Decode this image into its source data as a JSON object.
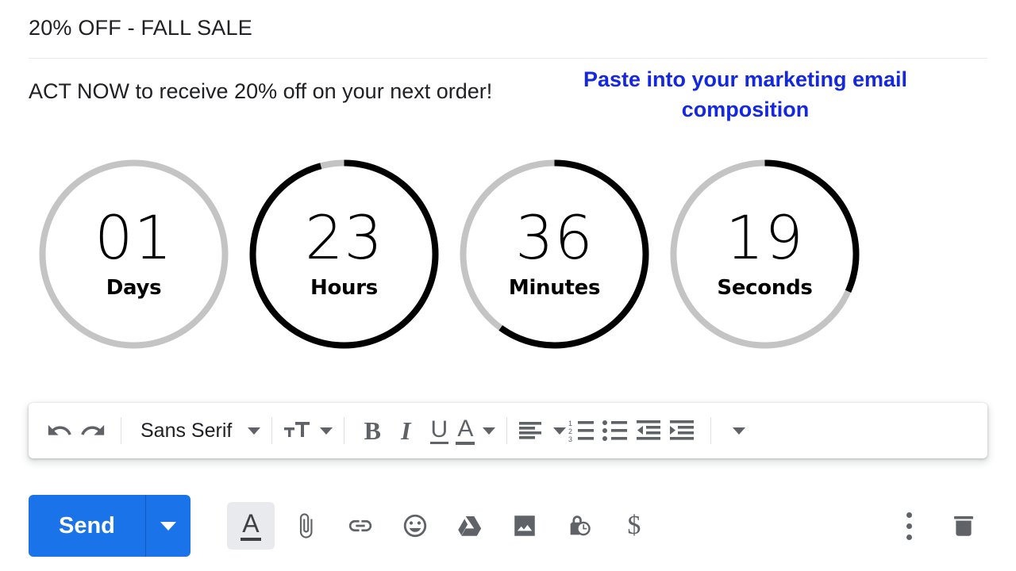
{
  "email": {
    "subject": "20% OFF - FALL SALE",
    "body_text": "ACT NOW to receive 20% off on your next order!",
    "annotation": "Paste into your marketing email composition"
  },
  "countdown": {
    "units": [
      {
        "value": "01",
        "label": "Days",
        "percent": 0,
        "arc_degrees": 0
      },
      {
        "value": "23",
        "label": "Hours",
        "percent": 96,
        "arc_degrees": 345
      },
      {
        "value": "36",
        "label": "Minutes",
        "percent": 60,
        "arc_degrees": 216
      },
      {
        "value": "19",
        "label": "Seconds",
        "percent": 32,
        "arc_degrees": 114
      }
    ],
    "track_color": "#c4c4c4",
    "progress_color": "#000000"
  },
  "format_toolbar": {
    "undo": "undo-icon",
    "redo": "redo-icon",
    "font_family": "Sans Serif",
    "text_size": "text-size-icon",
    "bold": "B",
    "italic": "I",
    "underline": "U",
    "text_color": "A",
    "align": "align-left-icon",
    "numbered_list": "numbered-list-icon",
    "bulleted_list": "bulleted-list-icon",
    "indent_less": "indent-less-icon",
    "indent_more": "indent-more-icon",
    "more_format": "more-format-options-icon",
    "numbered_digits": [
      "1",
      "2",
      "3"
    ]
  },
  "action_bar": {
    "send_label": "Send",
    "send_color": "#1a73e8",
    "icons": [
      "formatting-options-icon",
      "attach-file-icon",
      "insert-link-icon",
      "insert-emoji-icon",
      "insert-drive-icon",
      "insert-photo-icon",
      "confidential-mode-icon",
      "insert-money-icon"
    ],
    "money_symbol": "$",
    "more_options": "more-options-icon",
    "discard": "discard-draft-icon"
  }
}
